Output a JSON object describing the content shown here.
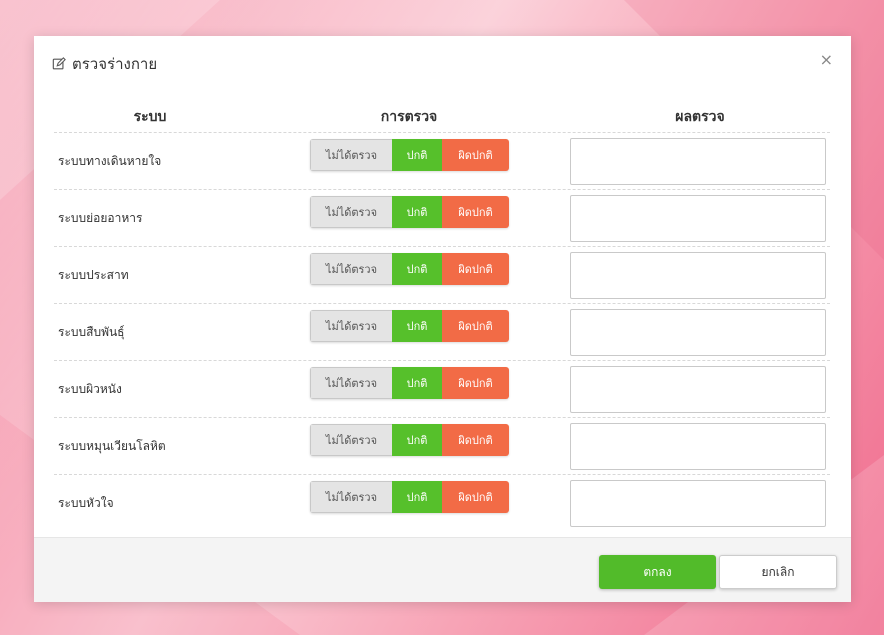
{
  "modal": {
    "title": "ตรวจร่างกาย",
    "close": "×"
  },
  "columns": {
    "system": "ระบบ",
    "exam": "การตรวจ",
    "result": "ผลตรวจ"
  },
  "options": {
    "not_examined": "ไม่ได้ตรวจ",
    "normal": "ปกติ",
    "abnormal": "ผิดปกติ"
  },
  "rows": [
    {
      "label": "ระบบทางเดินหายใจ",
      "result": ""
    },
    {
      "label": "ระบบย่อยอาหาร",
      "result": ""
    },
    {
      "label": "ระบบประสาท",
      "result": ""
    },
    {
      "label": "ระบบสืบพันธุ์",
      "result": ""
    },
    {
      "label": "ระบบผิวหนัง",
      "result": ""
    },
    {
      "label": "ระบบหมุนเวียนโลหิต",
      "result": ""
    },
    {
      "label": "ระบบหัวใจ",
      "result": ""
    }
  ],
  "footer": {
    "ok": "ตกลง",
    "cancel": "ยกเลิก"
  },
  "colors": {
    "normal": "#56c02b",
    "abnormal": "#f26b46",
    "ok_button": "#52bb2a"
  }
}
